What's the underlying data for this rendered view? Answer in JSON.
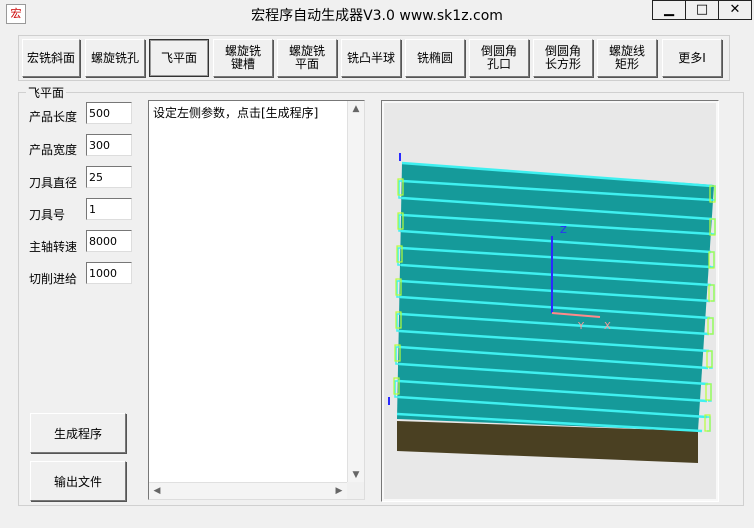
{
  "window": {
    "app_icon_glyph": "宏",
    "title": "宏程序自动生成器V3.0    www.sk1z.com",
    "minimize_glyph": "▁",
    "maximize_glyph": "□",
    "close_glyph": "✕"
  },
  "toolbar": {
    "buttons": [
      {
        "label": "宏铣斜面",
        "active": false
      },
      {
        "label": "螺旋铣孔",
        "active": false
      },
      {
        "label": "飞平面",
        "active": true
      },
      {
        "label": "螺旋铣 键槽",
        "active": false
      },
      {
        "label": "螺旋铣 平面",
        "active": false
      },
      {
        "label": "铣凸半球",
        "active": false
      },
      {
        "label": "铣椭圆",
        "active": false
      },
      {
        "label": "倒圆角 孔口",
        "active": false
      },
      {
        "label": "倒圆角 长方形",
        "active": false
      },
      {
        "label": "螺旋线 矩形",
        "active": false
      },
      {
        "label": "更多I",
        "active": false
      }
    ]
  },
  "panel": {
    "title": "飞平面",
    "params": [
      {
        "label": "产品长度",
        "value": "500"
      },
      {
        "label": "产品宽度",
        "value": "300"
      },
      {
        "label": "刀具直径",
        "value": "25"
      },
      {
        "label": "刀具号",
        "value": "1"
      },
      {
        "label": "主轴转速",
        "value": "8000"
      },
      {
        "label": "切削进给",
        "value": "1000"
      }
    ],
    "generate_label": "生成程序",
    "export_label": "输出文件",
    "output_text": "设定左侧参数，点击[生成程序]"
  },
  "scroll": {
    "up": "▲",
    "down": "▼",
    "left": "◀",
    "right": "▶"
  },
  "preview": {
    "axis_labels": {
      "x": "X",
      "y": "Y",
      "z": "Z"
    },
    "surface_color": "#159a9a",
    "toolpath_color": "#3ff0f0",
    "base_color": "#4a4022"
  }
}
